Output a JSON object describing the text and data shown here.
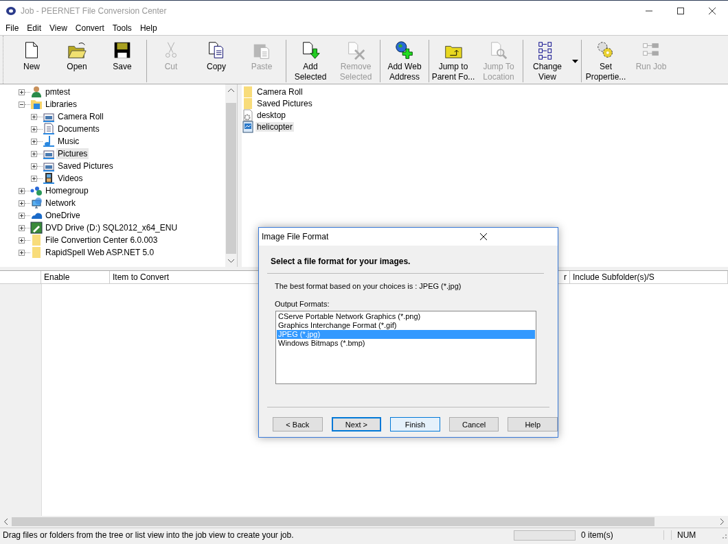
{
  "window": {
    "title": "Job - PEERNET File Conversion Center"
  },
  "menu": [
    "File",
    "Edit",
    "View",
    "Convert",
    "Tools",
    "Help"
  ],
  "toolbar": {
    "groups": [
      [
        {
          "kind": "new",
          "label": "New",
          "disabled": false
        },
        {
          "kind": "open",
          "label": "Open",
          "disabled": false
        },
        {
          "kind": "save",
          "label": "Save",
          "disabled": false
        }
      ],
      [
        {
          "kind": "cut",
          "label": "Cut",
          "disabled": true
        },
        {
          "kind": "copy",
          "label": "Copy",
          "disabled": false
        },
        {
          "kind": "paste",
          "label": "Paste",
          "disabled": true
        }
      ],
      [
        {
          "kind": "add",
          "label": "Add Selected",
          "disabled": false
        },
        {
          "kind": "remove",
          "label": "Remove Selected",
          "disabled": true
        }
      ],
      [
        {
          "kind": "web",
          "label": "Add Web Address",
          "disabled": false
        }
      ],
      [
        {
          "kind": "parent",
          "label": "Jump to Parent Fo...",
          "disabled": false
        },
        {
          "kind": "locate",
          "label": "Jump To Location",
          "disabled": true
        }
      ],
      [
        {
          "kind": "view",
          "label": "Change View",
          "disabled": false,
          "dropdown": true
        }
      ],
      [
        {
          "kind": "props",
          "label": "Set Propertie...",
          "disabled": false
        },
        {
          "kind": "run",
          "label": "Run Job",
          "disabled": true
        }
      ]
    ]
  },
  "tree": [
    {
      "kind": "user",
      "label": "pmtest",
      "expanded": false,
      "selected": false
    },
    {
      "kind": "library",
      "label": "Libraries",
      "expanded": true,
      "selected": false,
      "children": [
        {
          "kind": "pictures",
          "label": "Camera Roll",
          "expanded": false,
          "selected": false
        },
        {
          "kind": "documents",
          "label": "Documents",
          "expanded": false,
          "selected": false
        },
        {
          "kind": "music",
          "label": "Music",
          "expanded": false,
          "selected": false
        },
        {
          "kind": "pictures",
          "label": "Pictures",
          "expanded": false,
          "selected": true
        },
        {
          "kind": "pictures",
          "label": "Saved Pictures",
          "expanded": false,
          "selected": false
        },
        {
          "kind": "videos",
          "label": "Videos",
          "expanded": false,
          "selected": false
        }
      ]
    },
    {
      "kind": "homegroup",
      "label": "Homegroup",
      "expanded": false,
      "selected": false
    },
    {
      "kind": "network",
      "label": "Network",
      "expanded": false,
      "selected": false
    },
    {
      "kind": "onedrive",
      "label": "OneDrive",
      "expanded": false,
      "selected": false
    },
    {
      "kind": "dvd",
      "label": "DVD Drive (D:) SQL2012_x64_ENU",
      "expanded": false,
      "selected": false
    },
    {
      "kind": "folder",
      "label": "File Convertion Center 6.0.003",
      "expanded": false,
      "selected": false
    },
    {
      "kind": "folder",
      "label": "RapidSpell Web ASP.NET 5.0",
      "expanded": false,
      "selected": false
    }
  ],
  "files": [
    {
      "kind": "folder",
      "label": "Camera Roll",
      "selected": false
    },
    {
      "kind": "folder",
      "label": "Saved Pictures",
      "selected": false
    },
    {
      "kind": "settings",
      "label": "desktop",
      "selected": false
    },
    {
      "kind": "image",
      "label": "helicopter",
      "selected": true
    }
  ],
  "job_table": {
    "columns": [
      "Enable",
      "Item to Convert",
      "r",
      "Include Subfolder(s)/S"
    ]
  },
  "dialog": {
    "title": "Image File Format",
    "heading": "Select a file format for your images.",
    "info": "The best format based on your choices is : JPEG (*.jpg)",
    "list_label": "Output Formats:",
    "formats": [
      {
        "label": "CServe Portable Network Graphics (*.png)",
        "selected": false
      },
      {
        "label": "Graphics Interchange Format (*.gif)",
        "selected": false
      },
      {
        "label": "JPEG (*.jpg)",
        "selected": true
      },
      {
        "label": "Windows Bitmaps (*.bmp)",
        "selected": false
      }
    ],
    "buttons": [
      {
        "label": "< Back",
        "kind": "normal"
      },
      {
        "label": "Next >",
        "kind": "default"
      },
      {
        "label": "Finish",
        "kind": "focused"
      },
      {
        "label": "Cancel",
        "kind": "normal"
      },
      {
        "label": "Help",
        "kind": "normal"
      }
    ]
  },
  "status_bar": {
    "message": "Drag files or folders from the tree or list view into the job view to create your job.",
    "count": "0 item(s)",
    "num": "NUM"
  }
}
